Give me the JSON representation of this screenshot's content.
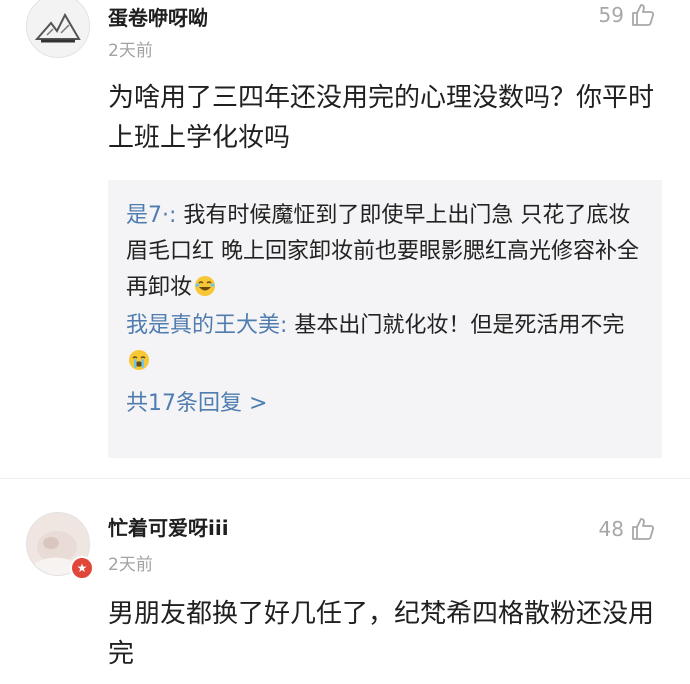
{
  "comments": [
    {
      "username": "蛋卷咿呀呦",
      "time": "2天前",
      "likes": "59",
      "body": "为啥用了三四年还没用完的心理没数吗？你平时上班上学化妆吗",
      "replies": [
        {
          "name": "是7·:",
          "text": "我有时候魔怔到了即使早上出门急 只花了底妆眉毛口红 晚上回家卸妆前也要眼影腮红高光修容补全再卸妆",
          "emoji": "laugh-cry-emoji"
        },
        {
          "name": "我是真的王大美:",
          "text": "基本出门就化妆！但是死活用不完",
          "emoji": "crying-emoji"
        }
      ],
      "more_replies": "共17条回复 >"
    },
    {
      "username": "忙着可爱呀iii",
      "time": "2天前",
      "likes": "48",
      "body": "男朋友都换了好几任了，纪梵希四格散粉还没用完"
    }
  ],
  "icons": {
    "like": "thumbs-up-icon",
    "badge": "star-badge-icon"
  },
  "colors": {
    "link": "#507daf",
    "muted": "#a3a3a3",
    "reply_bg": "#f4f4f6",
    "badge": "#e0463a"
  }
}
